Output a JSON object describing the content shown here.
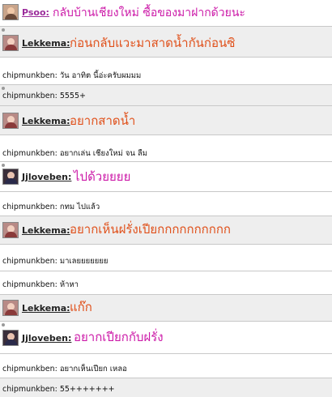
{
  "colors": {
    "orange_message": "#e0501a",
    "pink_message": "#cc1aa8",
    "username": "#222222",
    "username_purple": "#9b2c9b",
    "row_alt": "#eeeeee"
  },
  "rows": [
    {
      "kind": "big",
      "avatar": "avatar-psoo",
      "speaker": "Psoo:",
      "message": "กลับบ้านเชียงใหม่ ซื้อของมาฝากด้วยนะ",
      "message_color": "pink"
    },
    {
      "kind": "big",
      "avatar": "avatar-lekkema",
      "speaker": "Lekkema:",
      "message": "ก่อนกลับแวะมาสาดน้ำกันก่อนซิ",
      "message_color": "orange"
    },
    {
      "kind": "line",
      "text": "chipmunkben: วัน อาทิต นี้อ่ะครับผมมม"
    },
    {
      "kind": "line",
      "text": "chipmunkben: 5555+"
    },
    {
      "kind": "big",
      "avatar": "avatar-lekkema",
      "speaker": "Lekkema:",
      "message": "อยากสาดน้ำ",
      "message_color": "orange"
    },
    {
      "kind": "line",
      "text": "chipmunkben: อยากเล่น เชียงใหม่ จน ลืม"
    },
    {
      "kind": "big",
      "avatar": "avatar-jjloveben",
      "speaker": "Jjloveben:",
      "message": "ไปด้วยยยย",
      "message_color": "pink"
    },
    {
      "kind": "line",
      "text": "chipmunkben: กทม ไปแล้ว"
    },
    {
      "kind": "big",
      "avatar": "avatar-lekkema",
      "speaker": "Lekkema:",
      "message": "อยากเห็นฝรั่งเปียกกกกกกกกกก",
      "message_color": "orange"
    },
    {
      "kind": "line",
      "text": "chipmunkben: มาเลยยยยยยย"
    },
    {
      "kind": "line",
      "text": "chipmunkben: ห้าหา"
    },
    {
      "kind": "big",
      "avatar": "avatar-lekkema",
      "speaker": "Lekkema:",
      "message": "แก๊ก",
      "message_color": "orange"
    },
    {
      "kind": "big",
      "avatar": "avatar-jjloveben",
      "speaker": "Jjloveben:",
      "message": "อยากเปียกกับฝรั่ง",
      "message_color": "pink"
    },
    {
      "kind": "line",
      "text": "chipmunkben: อยากเห็นเปียก เหลอ"
    },
    {
      "kind": "line",
      "text": "chipmunkben: 55+++++++"
    }
  ]
}
